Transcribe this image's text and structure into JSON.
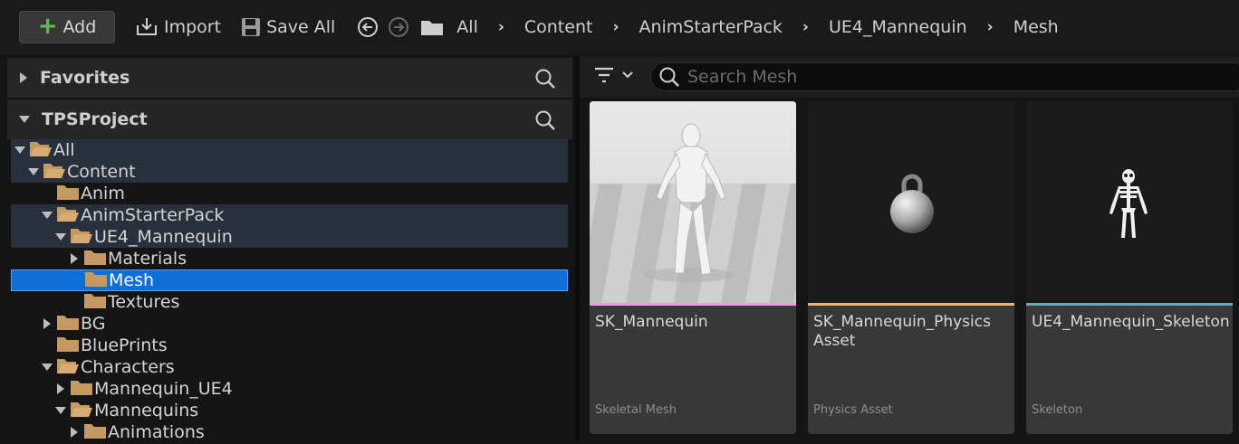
{
  "toolbar": {
    "add_label": "Add",
    "import_label": "Import",
    "save_all_label": "Save All",
    "breadcrumbs": [
      "All",
      "Content",
      "AnimStarterPack",
      "UE4_Mannequin",
      "Mesh"
    ]
  },
  "sources": {
    "favorites_label": "Favorites",
    "project_label": "TPSProject",
    "tree": [
      {
        "label": "All",
        "depth": 0,
        "expanded": true,
        "highlight": true
      },
      {
        "label": "Content",
        "depth": 1,
        "expanded": true,
        "highlight": true
      },
      {
        "label": "Anim",
        "depth": 2,
        "expanded": null
      },
      {
        "label": "AnimStarterPack",
        "depth": 2,
        "expanded": true,
        "highlight": true
      },
      {
        "label": "UE4_Mannequin",
        "depth": 3,
        "expanded": true,
        "highlight": true
      },
      {
        "label": "Materials",
        "depth": 4,
        "expanded": false
      },
      {
        "label": "Mesh",
        "depth": 4,
        "expanded": null,
        "selected": true
      },
      {
        "label": "Textures",
        "depth": 4,
        "expanded": null
      },
      {
        "label": "BG",
        "depth": 2,
        "expanded": false
      },
      {
        "label": "BluePrints",
        "depth": 2,
        "expanded": null
      },
      {
        "label": "Characters",
        "depth": 2,
        "expanded": true
      },
      {
        "label": "Mannequin_UE4",
        "depth": 3,
        "expanded": false
      },
      {
        "label": "Mannequins",
        "depth": 3,
        "expanded": true
      },
      {
        "label": "Animations",
        "depth": 4,
        "expanded": false
      }
    ]
  },
  "content": {
    "search_placeholder": "Search Mesh",
    "assets": [
      {
        "name": "SK_Mannequin",
        "type": "Skeletal Mesh",
        "color": "#e89ee0",
        "icon": "mannequin-preview"
      },
      {
        "name": "SK_Mannequin_Physics Asset",
        "type": "Physics Asset",
        "color": "#e8b86a",
        "icon": "kettlebell-icon"
      },
      {
        "name": "UE4_Mannequin_Skeleton",
        "type": "Skeleton",
        "color": "#6aa8c0",
        "icon": "skeleton-icon"
      }
    ]
  },
  "colors": {
    "folder": "#c49a62",
    "selection": "#0f6fd8",
    "add_plus": "#5fc34a"
  }
}
